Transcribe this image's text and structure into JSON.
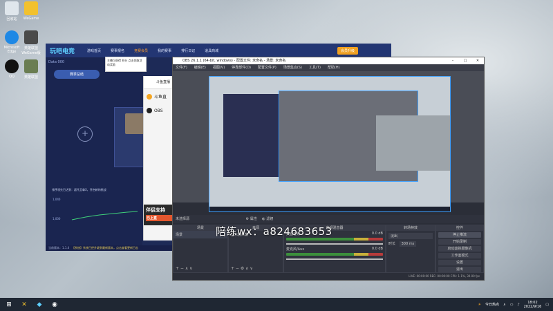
{
  "desktop": {
    "icons": [
      {
        "label": "回收站",
        "color": "#dfe6ec"
      },
      {
        "label": "WeGame",
        "color": "#f2c12e"
      },
      {
        "label": "Microsoft Edge",
        "color": "#1e88e5"
      },
      {
        "label": "英雄联盟WeGame版",
        "color": "#4a4a4a"
      },
      {
        "label": "QQ",
        "color": "#111111"
      },
      {
        "label": "英雄联盟",
        "color": "#6a7d52"
      }
    ]
  },
  "game_window": {
    "logo": "玩吧电竞",
    "tabs": [
      "游戏首页",
      "赛事报名",
      "竞赛会员",
      "我的赛事",
      "排行日记",
      "道具商城"
    ],
    "active_tab": 2,
    "vip_label": "会员升级",
    "side_title": "赛季总结",
    "badge": "Data 000",
    "chart_label": "排序领先已达到：超凡至尊X，开启新的挑战",
    "chart_y": [
      "1,040",
      "1,000"
    ],
    "status": "当前版本：1.1.4",
    "status_link": "【系统】系统已经升级到最新版本，点击查看更新日志"
  },
  "tooltip": {
    "text": "主播可获得 积分 点击领取活动奖励"
  },
  "stream_app": {
    "header": "斗鱼直播",
    "item1": "斗鱼直",
    "item2": "OBS",
    "banner": "伴侣支持",
    "banner_sub": "已上直"
  },
  "obs": {
    "title": "OBS 26.1.1 (64-bit, windows) - 配置文件: 未命名 - 场景: 未命名",
    "menus": [
      "文件(F)",
      "编辑(E)",
      "视图(V)",
      "停靠部件(D)",
      "配置文件(P)",
      "场景集合(S)",
      "工具(T)",
      "帮助(H)"
    ],
    "source_bar": [
      "未选择源",
      "属性",
      "滤镜"
    ],
    "panels": {
      "scenes": {
        "title": "场景",
        "items": [
          "场景"
        ]
      },
      "sources": {
        "title": "来源",
        "items": [
          "显示器采集"
        ]
      },
      "mixer": {
        "title": "音频混音器",
        "channels": [
          "桌面音频",
          "麦克风/Aux"
        ],
        "levels": [
          "0.0 dB",
          "0.0 dB"
        ]
      },
      "transitions": {
        "title": "转场特效",
        "type": "淡出",
        "duration_label": "时长",
        "duration": "300 ms"
      },
      "controls": {
        "title": "控件",
        "buttons": [
          "停止推流",
          "开始录制",
          "启动虚拟摄像机",
          "工作室模式",
          "设置",
          "退出"
        ]
      }
    },
    "status": "LIVE: 00:00:00   REC: 00:00:00   CPU: 1.1%, 30.00 fps"
  },
  "watermark": "陪练wx：a824683653",
  "taskbar": {
    "weather": "今日热点",
    "time": "18:02",
    "date": "2022/9/16"
  }
}
